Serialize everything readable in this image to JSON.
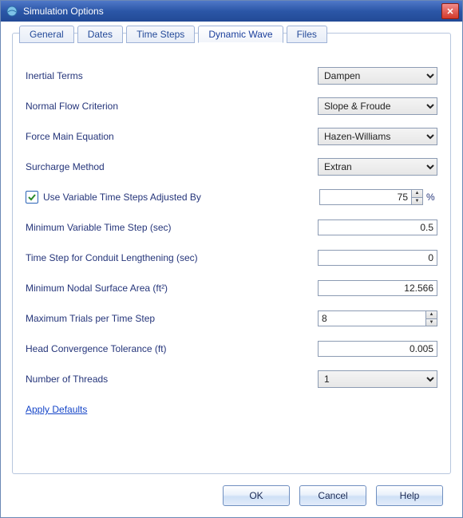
{
  "window": {
    "title": "Simulation Options"
  },
  "tabs": {
    "general": "General",
    "dates": "Dates",
    "timeSteps": "Time Steps",
    "dynamicWave": "Dynamic Wave",
    "files": "Files",
    "active": "dynamicWave"
  },
  "labels": {
    "inertialTerms": "Inertial Terms",
    "normalFlow": "Normal Flow Criterion",
    "forceMain": "Force Main Equation",
    "surcharge": "Surcharge Method",
    "useVarStep": "Use Variable Time Steps  Adjusted By",
    "minVarStep": "Minimum Variable Time Step (sec)",
    "conduitLen": "Time Step for Conduit Lengthening (sec)",
    "minNodalArea": "Minimum Nodal Surface Area (ft²)",
    "maxTrials": "Maximum Trials per Time Step",
    "headConv": "Head Convergence Tolerance (ft)",
    "numThreads": "Number of Threads",
    "pct": "%"
  },
  "values": {
    "inertialTerms": "Dampen",
    "normalFlow": "Slope & Froude",
    "forceMain": "Hazen-Williams",
    "surcharge": "Extran",
    "useVarStepChecked": true,
    "adjustedBy": "75",
    "minVarStep": "0.5",
    "conduitLen": "0",
    "minNodalArea": "12.566",
    "maxTrials": "8",
    "headConv": "0.005",
    "numThreads": "1"
  },
  "link": {
    "applyDefaults": "Apply Defaults"
  },
  "buttons": {
    "ok": "OK",
    "cancel": "Cancel",
    "help": "Help"
  },
  "icons": {
    "check": "✓",
    "up": "▲",
    "down": "▼",
    "close": "✕"
  }
}
